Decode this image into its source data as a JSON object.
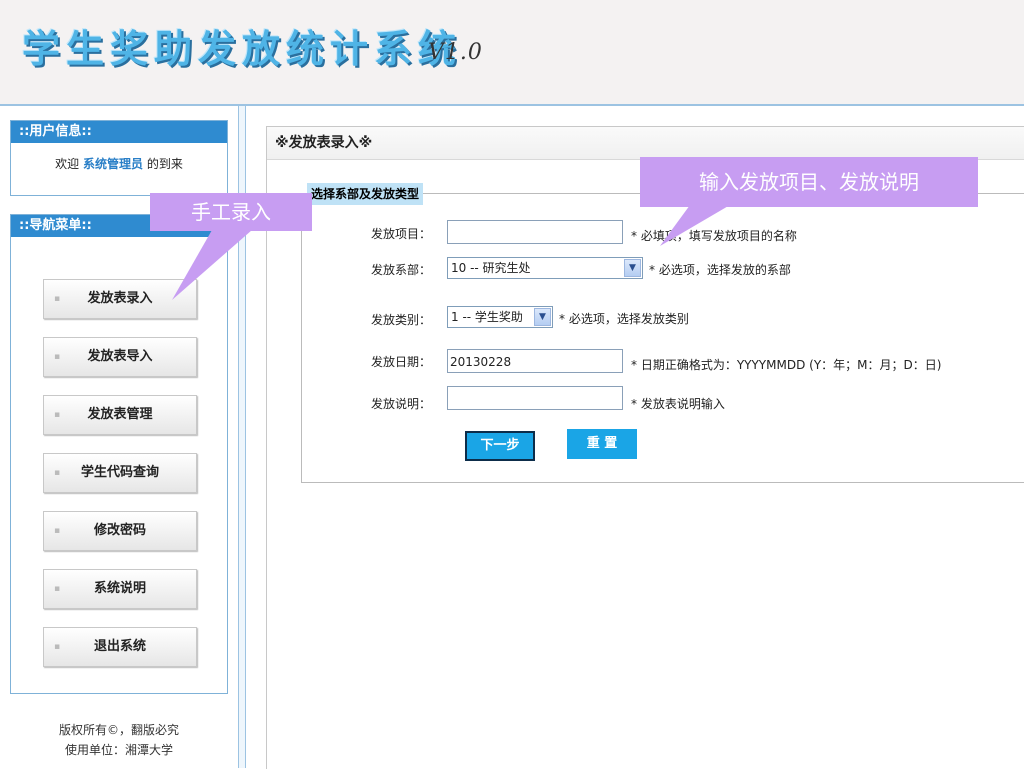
{
  "header": {
    "logo_text": "学生奖助发放统计系统",
    "version": "V1.0"
  },
  "user_panel": {
    "title": "::用户信息::",
    "welcome_prefix": "欢迎",
    "role": "系统管理员",
    "welcome_suffix": "的到来"
  },
  "nav_panel": {
    "title": "::导航菜单::",
    "items": [
      {
        "label": "发放表录入"
      },
      {
        "label": "发放表导入"
      },
      {
        "label": "发放表管理"
      },
      {
        "label": "学生代码查询"
      },
      {
        "label": "修改密码"
      },
      {
        "label": "系统说明"
      },
      {
        "label": "退出系统"
      }
    ]
  },
  "footer": {
    "line1": "版权所有©，翻版必究",
    "line2": "使用单位：湘潭大学"
  },
  "main": {
    "title": "※发放表录入※",
    "legend": "选择系部及发放类型",
    "fields": {
      "item": {
        "label": "发放项目：",
        "value": "",
        "hint": "*  必填项，填写发放项目的名称"
      },
      "dept": {
        "label": "发放系部：",
        "value": "10 -- 研究生处",
        "hint": "*  必选项，选择发放的系部"
      },
      "type": {
        "label": "发放类别：",
        "value": "1 -- 学生奖助",
        "hint": "*  必选项，选择发放类别"
      },
      "date": {
        "label": "发放日期：",
        "value": "20130228",
        "hint": "*  日期正确格式为：YYYYMMDD (Y：年；M：月；D：日)"
      },
      "desc": {
        "label": "发放说明：",
        "value": "",
        "hint": "*  发放表说明输入"
      }
    },
    "buttons": {
      "next": "下一步",
      "reset": "重 置"
    }
  },
  "annotations": {
    "manual_entry": "手工录入",
    "input_hint": "输入发放项目、发放说明"
  },
  "colors": {
    "accent": "#2f8bd0",
    "button": "#1aa5e6",
    "callout": "#c79df2"
  }
}
